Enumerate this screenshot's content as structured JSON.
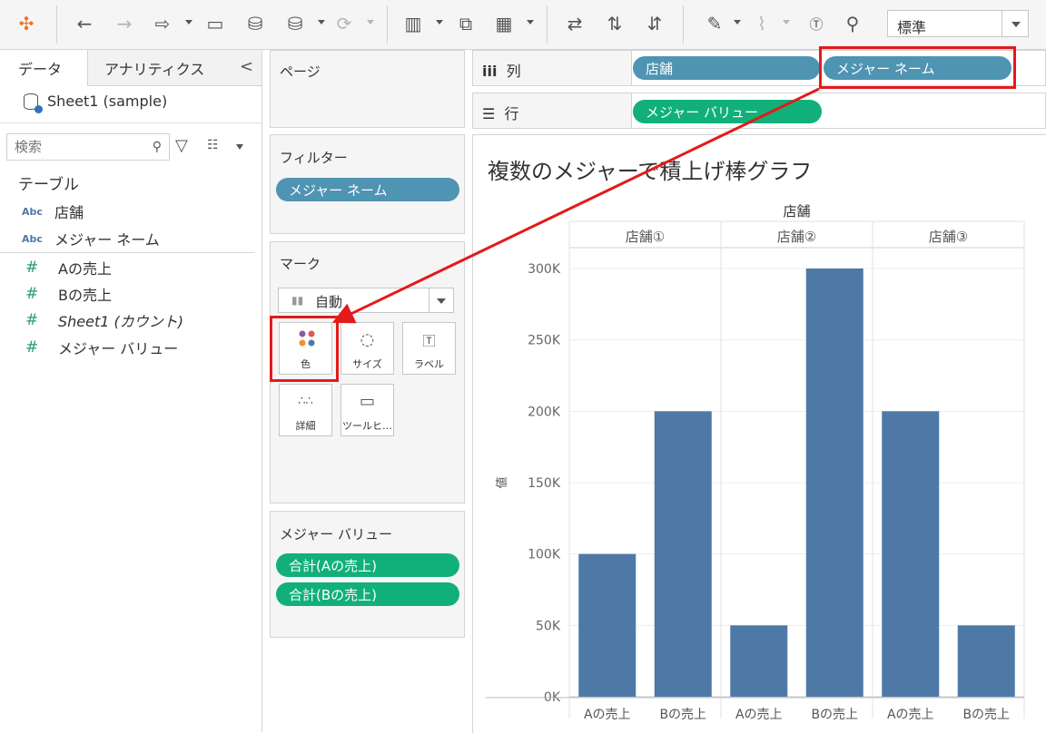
{
  "toolbar": {
    "icons": [
      "tableau-logo-icon",
      "undo-icon",
      "redo-icon",
      "replay-icon",
      "save-icon",
      "new-datasource-icon",
      "pause-icon",
      "refresh-icon",
      "new-worksheet-icon",
      "duplicate-icon",
      "clear-icon",
      "swap-icon",
      "sort-ascending-icon",
      "sort-descending-icon",
      "highlight-icon",
      "group-icon",
      "label-icon",
      "pin-icon"
    ],
    "fit_label": "標準"
  },
  "data_pane": {
    "tab_data": "データ",
    "tab_analytics": "アナリティクス",
    "collapse": "<",
    "datasource": "Sheet1 (sample)",
    "search_placeholder": "検索",
    "section_table": "テーブル",
    "dimensions": [
      {
        "type": "Abc",
        "label": "店舗"
      },
      {
        "type": "Abc",
        "label": "メジャー ネーム"
      }
    ],
    "measures": [
      {
        "type": "#",
        "label": "Aの売上"
      },
      {
        "type": "#",
        "label": "Bの売上"
      },
      {
        "type": "#",
        "label": "Sheet1 (カウント)"
      },
      {
        "type": "#",
        "label": "メジャー バリュー"
      }
    ]
  },
  "cards": {
    "pages_title": "ページ",
    "filters_title": "フィルター",
    "filter_pill": "メジャー ネーム",
    "marks_title": "マーク",
    "mark_type": "自動",
    "mark_buttons": [
      {
        "label": "色",
        "icon": "color-icon"
      },
      {
        "label": "サイズ",
        "icon": "size-icon"
      },
      {
        "label": "ラベル",
        "icon": "label-icon"
      },
      {
        "label": "詳細",
        "icon": "detail-icon"
      },
      {
        "label": "ツールヒ…",
        "icon": "tooltip-icon"
      }
    ],
    "measure_values_title": "メジャー バリュー",
    "measure_values_pills": [
      "合計(Aの売上)",
      "合計(Bの売上)"
    ]
  },
  "shelves": {
    "columns_label": "列",
    "columns_pills": [
      "店舗",
      "メジャー ネーム"
    ],
    "rows_label": "行",
    "rows_pills": [
      "メジャー バリュー"
    ]
  },
  "viz": {
    "title": "複数のメジャーで積上げ棒グラフ"
  },
  "colors": {
    "bar": "#4e79a7",
    "pill_dimension": "#4f94b2",
    "pill_measure": "#11b07a",
    "highlight": "#e41a1a"
  },
  "chart_data": {
    "type": "bar",
    "column_header": "店舗",
    "groups": [
      "店舗①",
      "店舗②",
      "店舗③"
    ],
    "categories": [
      "Aの売上",
      "Bの売上"
    ],
    "series": [
      {
        "group": "店舗①",
        "values": [
          100000,
          200000
        ]
      },
      {
        "group": "店舗②",
        "values": [
          50000,
          300000
        ]
      },
      {
        "group": "店舗③",
        "values": [
          200000,
          50000
        ]
      }
    ],
    "ylabel": "値",
    "ylim": [
      0,
      300000
    ],
    "yticks": [
      0,
      50000,
      100000,
      150000,
      200000,
      250000,
      300000
    ],
    "ytick_labels": [
      "0K",
      "50K",
      "100K",
      "150K",
      "200K",
      "250K",
      "300K"
    ],
    "grid": true
  }
}
